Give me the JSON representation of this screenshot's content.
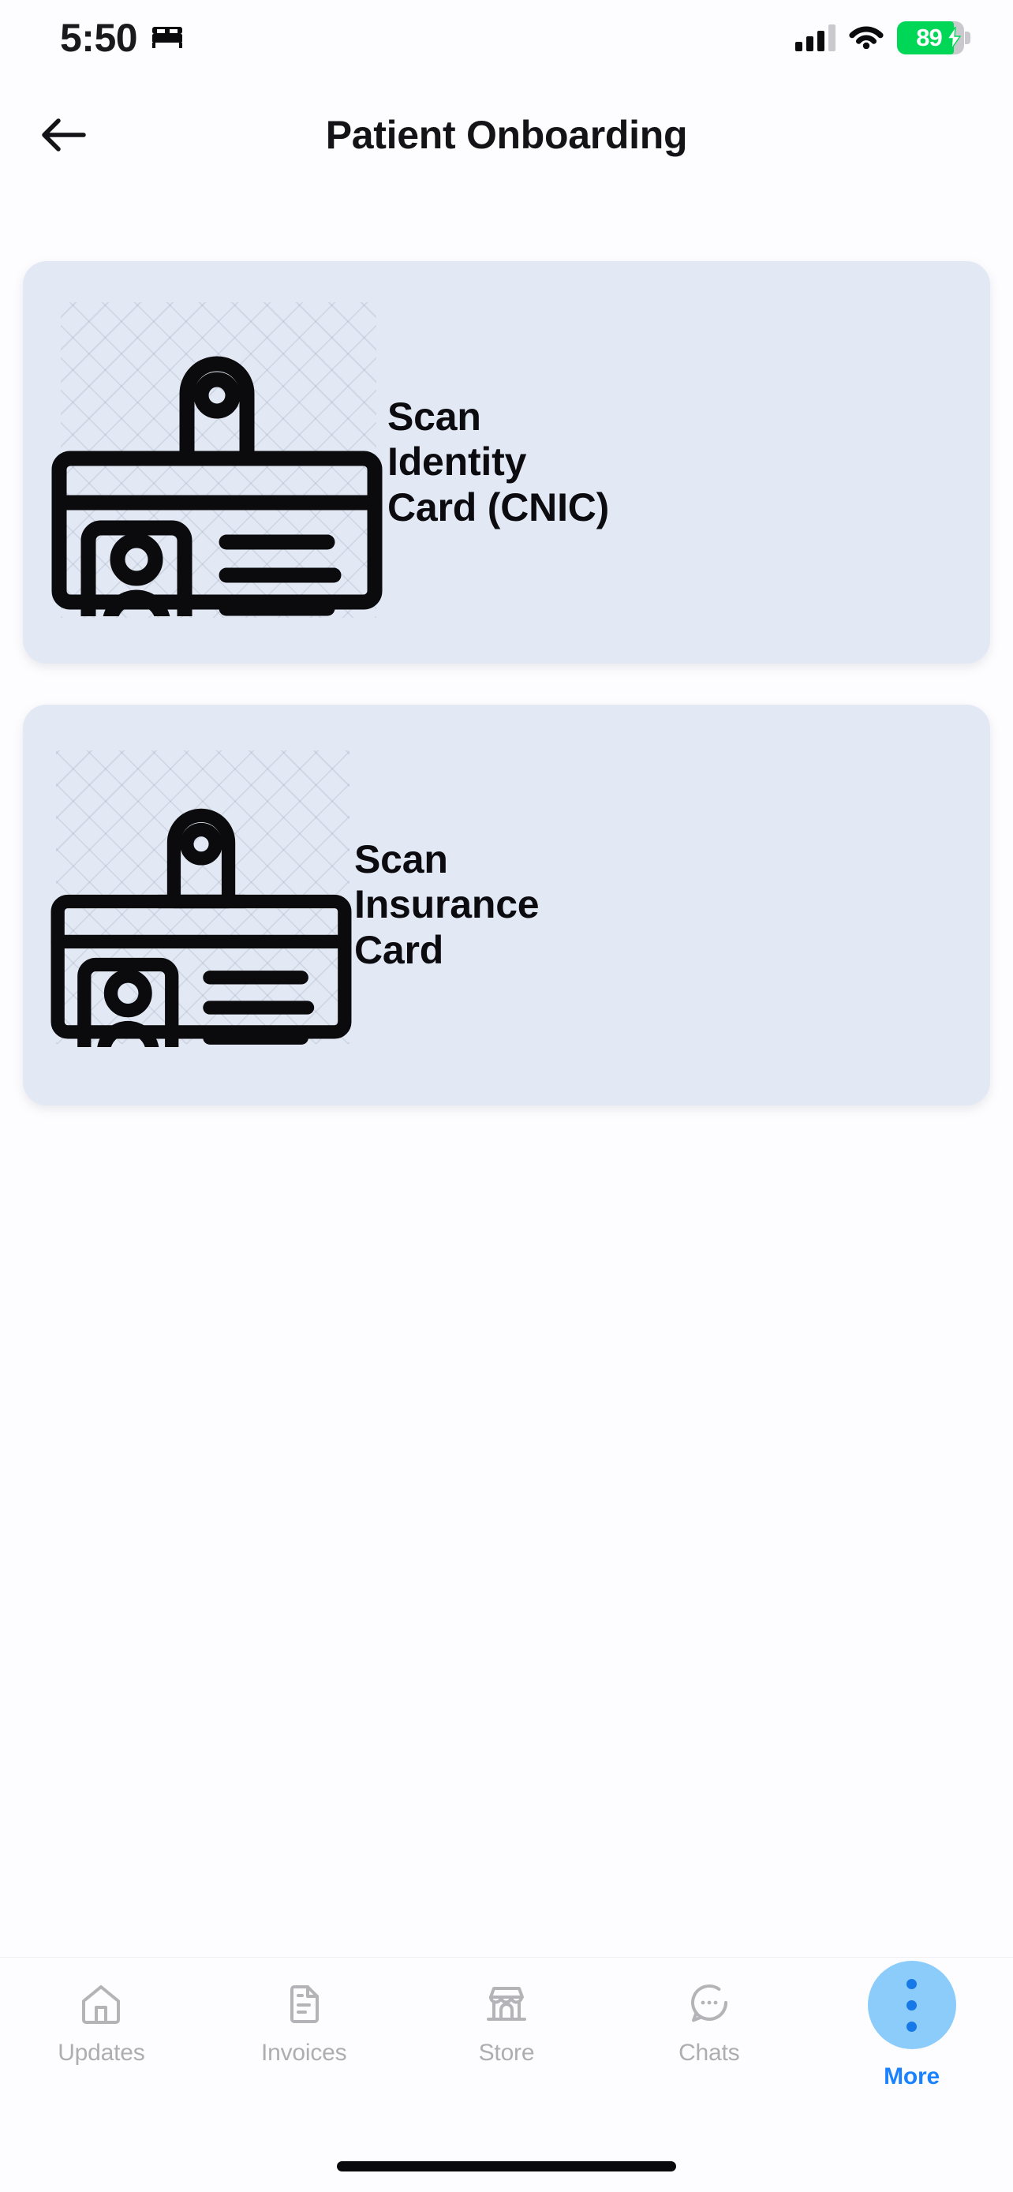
{
  "status_bar": {
    "time": "5:50",
    "location_icon": "bed-icon",
    "cellular_icon": "cellular-signal-icon",
    "wifi_icon": "wifi-icon",
    "battery_percent": "89",
    "battery_charging_icon": "charging-bolt-icon",
    "battery_color": "#00D757"
  },
  "header": {
    "back_icon": "arrow-left-icon",
    "title": "Patient Onboarding"
  },
  "cards": [
    {
      "id": "cnic",
      "label": "Scan Identity Card (CNIC)",
      "icon": "id-badge-icon",
      "background": "#E3E9F4"
    },
    {
      "id": "insurance",
      "label": "Scan Insurance Card",
      "icon": "id-badge-icon",
      "background": "#E3E9F4"
    }
  ],
  "tab_bar": {
    "inactive_color": "#AEAEB2",
    "active_color": "#1A82FF",
    "more_bubble_color": "#8BCCFA",
    "items": [
      {
        "label": "Updates",
        "icon": "home-icon",
        "active": false
      },
      {
        "label": "Invoices",
        "icon": "document-icon",
        "active": false
      },
      {
        "label": "Store",
        "icon": "storefront-icon",
        "active": false
      },
      {
        "label": "Chats",
        "icon": "chat-bubble-icon",
        "active": false
      },
      {
        "label": "More",
        "icon": "more-dots-icon",
        "active": true
      }
    ]
  }
}
